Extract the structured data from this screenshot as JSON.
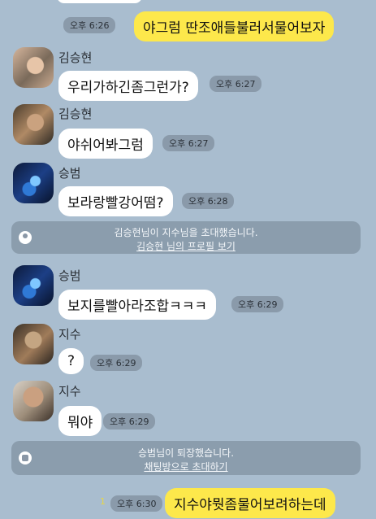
{
  "messages": [
    {
      "side": "right",
      "text": "야그럼 딴조애들불러서물어보자",
      "time": "오후 6:26"
    },
    {
      "side": "left",
      "sender": "김승현",
      "text": "우리가하긴좀그런가?",
      "time": "오후 6:27"
    },
    {
      "side": "left",
      "sender": "김승현",
      "text": "야쉬어봐그럼",
      "time": "오후 6:27"
    },
    {
      "side": "left",
      "sender": "승범",
      "text": "보라랑빨강어떰?",
      "time": "오후 6:28"
    },
    {
      "side": "left",
      "sender": "승범",
      "text": "보지를빨아라조합ㅋㅋㅋ",
      "time": "오후 6:29"
    },
    {
      "side": "left",
      "sender": "지수",
      "text": "?",
      "time": "오후 6:29"
    },
    {
      "side": "left",
      "sender": "지수",
      "text": "뭐야",
      "time": "오후 6:29"
    },
    {
      "side": "right",
      "text": "지수야뭣좀물어보려하는데",
      "time": "오후 6:30",
      "read": "1"
    }
  ],
  "notices": [
    {
      "text": "김승현님이 지수님을 초대했습니다.",
      "link": "김승현 님의 프로필 보기",
      "icon": "invite-icon"
    },
    {
      "text": "승범님이 퇴장했습니다.",
      "link": "채팅방으로 초대하기",
      "icon": "exit-icon"
    }
  ],
  "colors": {
    "background": "#a9bdcf",
    "mine": "#fde84b",
    "theirs": "#ffffff"
  }
}
